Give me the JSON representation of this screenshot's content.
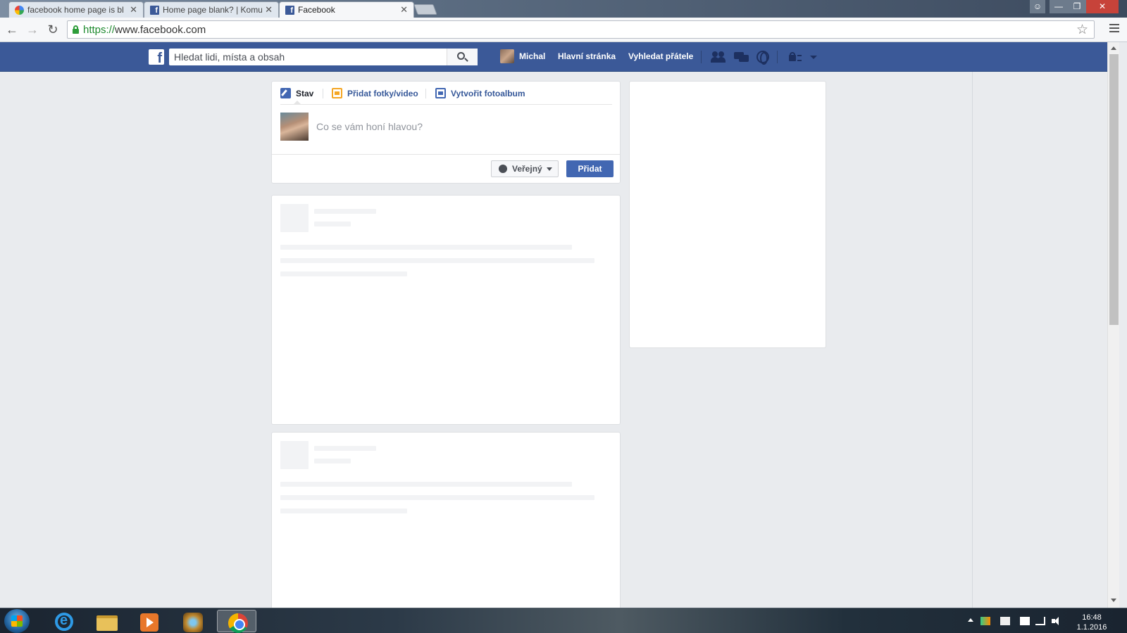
{
  "browser": {
    "tabs": [
      {
        "title": "facebook home page is bl",
        "favicon": "google-favicon",
        "active": false
      },
      {
        "title": "Home page blank? | Komu",
        "favicon": "facebook-favicon",
        "active": false
      },
      {
        "title": "Facebook",
        "favicon": "facebook-favicon",
        "active": true
      }
    ],
    "url_protocol": "https://",
    "url_rest": "www.facebook.com",
    "close_glyph": "✕"
  },
  "facebook": {
    "search_placeholder": "Hledat lidi, místa a obsah",
    "user_name": "Michal",
    "nav_home": "Hlavní stránka",
    "nav_find_friends": "Vyhledat přátele",
    "icons": [
      "friends-icon",
      "messages-icon",
      "notifications-globe-icon",
      "privacy-lock-icon",
      "account-menu-caret-icon"
    ]
  },
  "composer": {
    "tab_status": "Stav",
    "tab_photo": "Přidat fotky/video",
    "tab_album": "Vytvořit fotoalbum",
    "placeholder": "Co se vám honí hlavou?",
    "privacy_label": "Veřejný",
    "post_label": "Přidat"
  },
  "taskbar": {
    "apps": [
      "internet-explorer",
      "file-explorer",
      "media-player",
      "hearthstone",
      "chrome"
    ],
    "active_app": "chrome",
    "time": "16:48",
    "date": "1.1.2016"
  },
  "colors": {
    "fb_blue": "#3b5998",
    "post_button": "#4267b2",
    "page_bg": "#e9ebee"
  }
}
